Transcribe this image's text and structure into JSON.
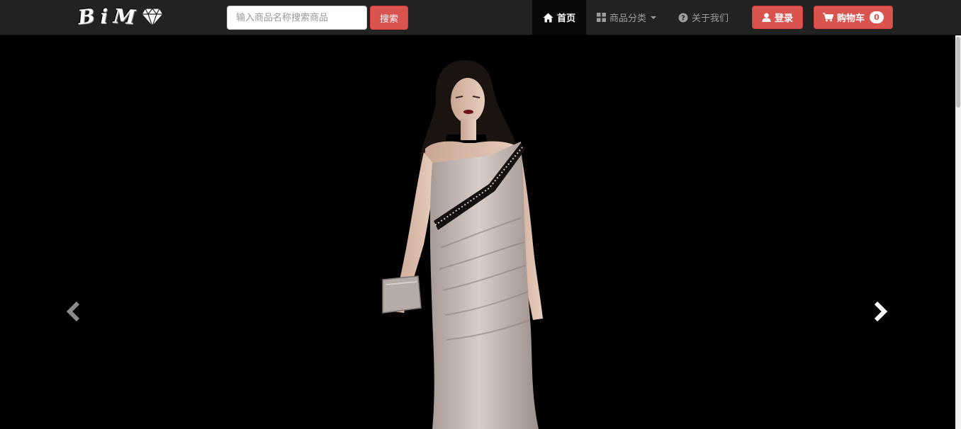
{
  "brand": {
    "name": "BiM",
    "letters": [
      "B",
      "i",
      "M"
    ],
    "logo_icon": "diamond-icon"
  },
  "search": {
    "placeholder": "输入商品名称搜索商品",
    "value": "",
    "button_label": "搜索"
  },
  "nav": {
    "items": [
      {
        "label": "首页",
        "icon": "home-icon",
        "active": true
      },
      {
        "label": "商品分类",
        "icon": "grid-icon",
        "active": false,
        "dropdown": true
      },
      {
        "label": "关于我们",
        "icon": "question-circle-icon",
        "active": false
      }
    ]
  },
  "actions": {
    "login_label": "登录",
    "login_icon": "user-icon",
    "cart_label": "购物车",
    "cart_icon": "shopping-cart-icon",
    "cart_count": "0"
  },
  "carousel": {
    "slide_image": "model in pale draped gown on runway",
    "prev_icon": "chevron-left-icon",
    "next_icon": "chevron-right-icon"
  },
  "colors": {
    "navbar": "#222222",
    "accent": "#d9534f",
    "active_nav": "#080808",
    "nav_text": "#9d9d9d",
    "carousel_bg": "#000000"
  }
}
